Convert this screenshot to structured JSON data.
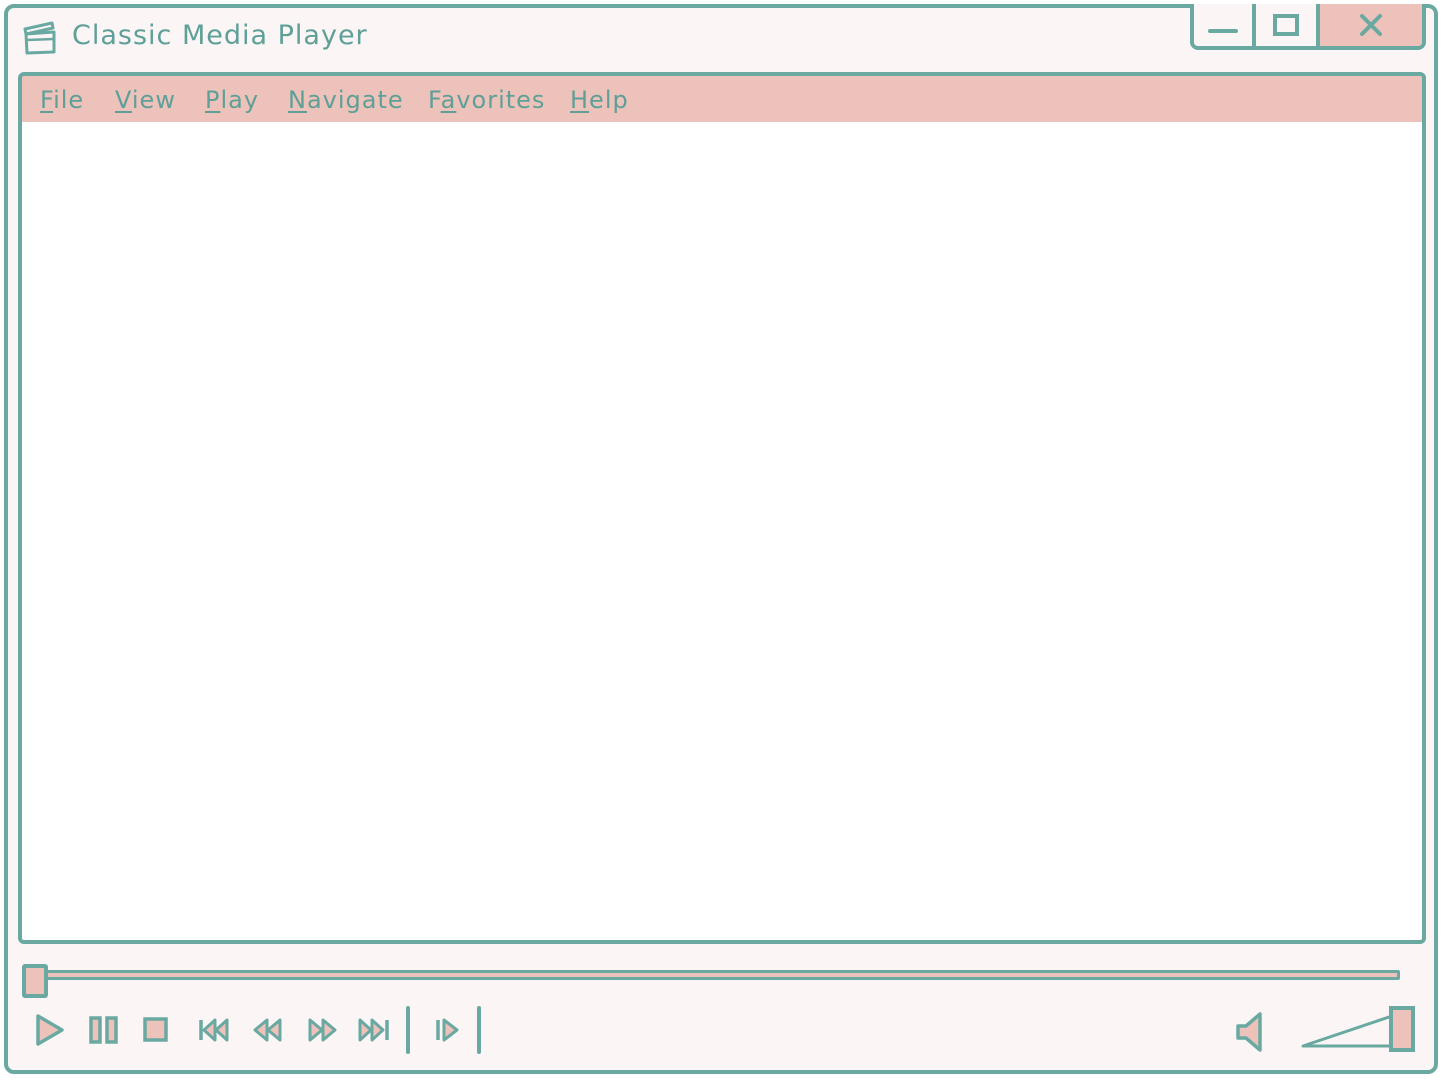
{
  "window": {
    "title": "Classic Media Player",
    "app_icon": "clapperboard-icon"
  },
  "window_controls": {
    "minimize_icon": "minimize-icon",
    "maximize_icon": "maximize-icon",
    "close_icon": "close-icon"
  },
  "menu": {
    "items": [
      {
        "id": "file",
        "label": "File",
        "hotkey": "F",
        "rest": "ile"
      },
      {
        "id": "view",
        "label": "View",
        "hotkey": "V",
        "rest": "iew"
      },
      {
        "id": "play",
        "label": "Play",
        "hotkey": "P",
        "rest": "lay"
      },
      {
        "id": "navigate",
        "label": "Navigate",
        "hotkey": "N",
        "rest": "avigate"
      },
      {
        "id": "favorites",
        "label": "Favorites",
        "pre": "F",
        "hotkey": "a",
        "rest": "vorites"
      },
      {
        "id": "help",
        "label": "Help",
        "hotkey": "H",
        "rest": "elp"
      }
    ]
  },
  "playback": {
    "seek_position": 0.0,
    "volume_level": 1.0,
    "controls": [
      "play-icon",
      "pause-icon",
      "stop-icon",
      "skip-previous-icon",
      "rewind-icon",
      "fast-forward-icon",
      "skip-next-icon",
      "frame-step-icon"
    ],
    "volume_icon": "speaker-icon"
  },
  "colors": {
    "accent": "#6aa9a1",
    "highlight": "#edc2bb",
    "background": "#fbf6f5",
    "video": "#ffffff"
  }
}
